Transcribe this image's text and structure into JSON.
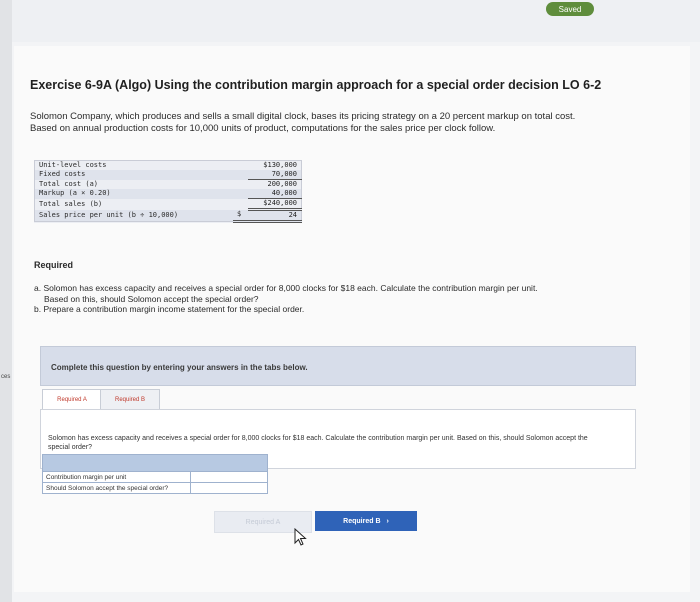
{
  "toolbar": {
    "save_label": "Saved"
  },
  "side_label": "ces",
  "header": {
    "title": "Exercise 6-9A (Algo) Using the contribution margin approach for a special order decision LO 6-2"
  },
  "intro": {
    "line1": "Solomon Company, which produces and sells a small digital clock, bases its pricing strategy on a 20 percent markup on total cost.",
    "line2": "Based on annual production costs for 10,000 units of product, computations for the sales price per clock follow."
  },
  "cost_table": {
    "rows": [
      {
        "label": "Unit-level costs",
        "value": "$130,000"
      },
      {
        "label": "Fixed costs",
        "value": "70,000"
      },
      {
        "label": "Total cost (a)",
        "value": "200,000"
      },
      {
        "label": "Markup (a × 0.20)",
        "value": "40,000"
      },
      {
        "label": "Total sales (b)",
        "value": "$240,000"
      },
      {
        "label": "Sales price per unit (b ÷ 10,000)",
        "currency": "$",
        "value": "24"
      }
    ]
  },
  "required": {
    "heading": "Required",
    "a_line1": "a. Solomon has excess capacity and receives a special order for 8,000 clocks for $18 each. Calculate the contribution margin per unit.",
    "a_line2": "Based on this, should Solomon accept the special order?",
    "b_line": "b. Prepare a contribution margin income statement for the special order."
  },
  "instructions": "Complete this question by entering your answers in the tabs below.",
  "tabs": [
    {
      "label": "Required A"
    },
    {
      "label": "Required B"
    }
  ],
  "tab_a": {
    "description": "Solomon has excess capacity and receives a special order for 8,000 clocks for $18 each. Calculate the contribution margin per unit. Based on this, should Solomon accept the special order?",
    "rows": [
      {
        "label": "Contribution margin per unit",
        "value": ""
      },
      {
        "label": "Should Solomon accept the special order?",
        "value": ""
      }
    ]
  },
  "nav": {
    "prev_label": "Required A",
    "next_label": "Required B",
    "next_arrow": "›"
  }
}
